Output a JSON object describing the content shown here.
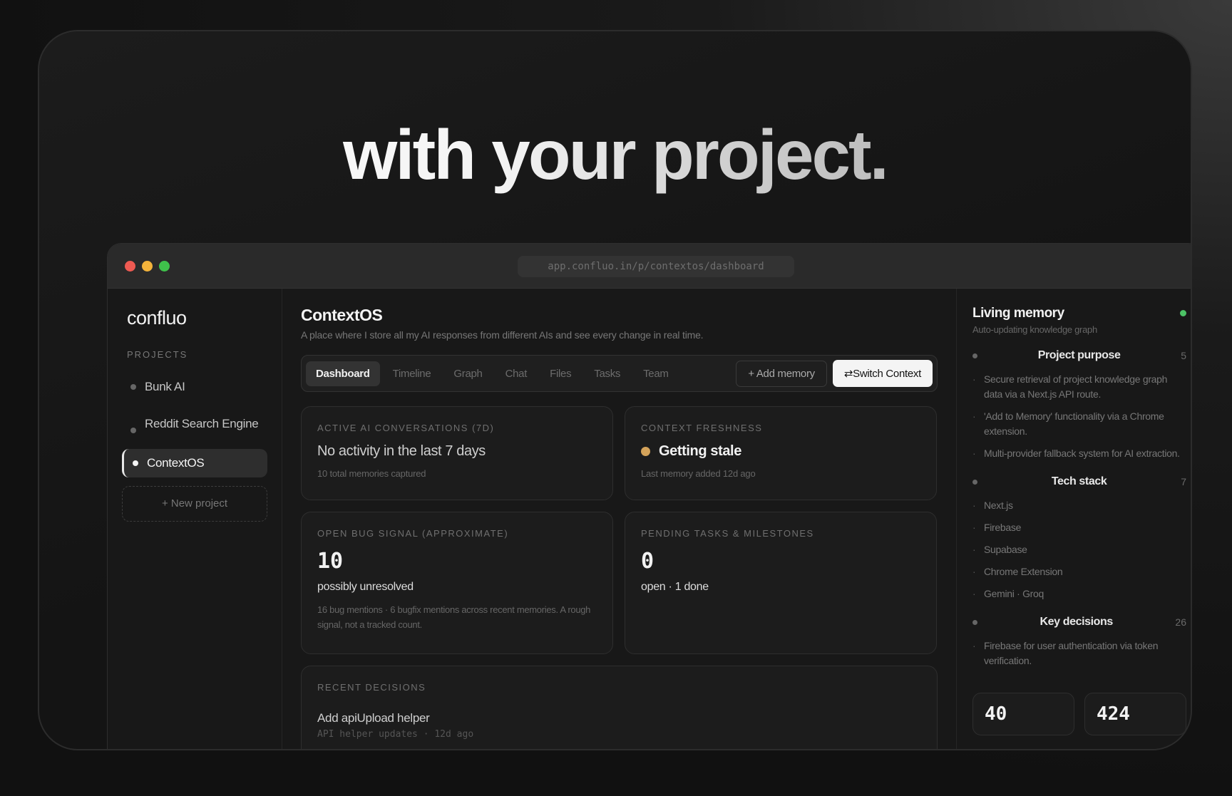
{
  "headline": "with your project.",
  "window": {
    "url": "app.confluo.in/p/contextos/dashboard"
  },
  "sidebar": {
    "logo": "confluo",
    "section_label": "PROJECTS",
    "projects": [
      {
        "label": "Bunk AI",
        "active": false
      },
      {
        "label": "Reddit Search Engine",
        "active": false
      },
      {
        "label": "ContextOS",
        "active": true
      }
    ],
    "new_project": "+ New project"
  },
  "main": {
    "title": "ContextOS",
    "subtitle": "A place where I store all my AI responses from different AIs and see every change in real time.",
    "tabs": [
      "Dashboard",
      "Timeline",
      "Graph",
      "Chat",
      "Files",
      "Tasks",
      "Team"
    ],
    "active_tab": "Dashboard",
    "add_memory": "+ Add memory",
    "switch_context": "⇄Switch Context",
    "cards": {
      "conversations": {
        "label": "ACTIVE AI CONVERSATIONS (7D)",
        "value": "No activity in the last 7 days",
        "note": "10 total memories captured"
      },
      "freshness": {
        "label": "CONTEXT FRESHNESS",
        "value": "Getting stale",
        "note": "Last memory added 12d ago",
        "status_color": "#d4a35a"
      },
      "bugs": {
        "label": "OPEN BUG SIGNAL (APPROXIMATE)",
        "value": "10",
        "sub": "possibly unresolved",
        "desc": "16 bug mentions · 6 bugfix mentions across recent memories. A rough signal, not a tracked count."
      },
      "tasks": {
        "label": "PENDING TASKS & MILESTONES",
        "value": "0",
        "sub": "open · 1 done"
      }
    },
    "decisions": {
      "label": "RECENT DECISIONS",
      "items": [
        {
          "title": "Add apiUpload helper",
          "meta": "API helper updates · 12d ago"
        }
      ]
    }
  },
  "memory": {
    "title": "Living memory",
    "subtitle": "Auto-updating knowledge graph",
    "live_color": "#4cc265",
    "groups": [
      {
        "name": "Project purpose",
        "count": "5",
        "items": [
          "Secure retrieval of project knowledge graph data via a Next.js API route.",
          "'Add to Memory' functionality via a Chrome extension.",
          "Multi-provider fallback system for AI extraction."
        ]
      },
      {
        "name": "Tech stack",
        "count": "7",
        "items": [
          "Next.js",
          "Firebase",
          "Supabase",
          "Chrome Extension",
          "Gemini · Groq"
        ]
      },
      {
        "name": "Key decisions",
        "count": "26",
        "items": [
          "Firebase for user authentication via token verification."
        ]
      }
    ],
    "stats": [
      "40",
      "424"
    ]
  }
}
